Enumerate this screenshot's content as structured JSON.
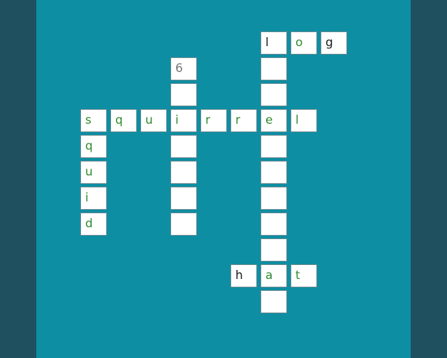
{
  "puzzle": {
    "cells": [
      {
        "letter": "l",
        "style": "dark"
      },
      {
        "letter": "o",
        "style": "green"
      },
      {
        "letter": "g",
        "style": "dark"
      },
      {
        "letter": "6",
        "style": "num"
      },
      {
        "letter": "",
        "style": "green"
      },
      {
        "letter": "",
        "style": "green"
      },
      {
        "letter": "",
        "style": "green"
      },
      {
        "letter": "s",
        "style": "green"
      },
      {
        "letter": "q",
        "style": "green"
      },
      {
        "letter": "u",
        "style": "green"
      },
      {
        "letter": "i",
        "style": "green"
      },
      {
        "letter": "r",
        "style": "green"
      },
      {
        "letter": "r",
        "style": "green"
      },
      {
        "letter": "e",
        "style": "green"
      },
      {
        "letter": "l",
        "style": "green"
      },
      {
        "letter": "q",
        "style": "green"
      },
      {
        "letter": "",
        "style": "green"
      },
      {
        "letter": "",
        "style": "green"
      },
      {
        "letter": "u",
        "style": "green"
      },
      {
        "letter": "",
        "style": "green"
      },
      {
        "letter": "",
        "style": "green"
      },
      {
        "letter": "i",
        "style": "green"
      },
      {
        "letter": "",
        "style": "green"
      },
      {
        "letter": "",
        "style": "green"
      },
      {
        "letter": "d",
        "style": "green"
      },
      {
        "letter": "",
        "style": "green"
      },
      {
        "letter": "",
        "style": "green"
      },
      {
        "letter": "",
        "style": "green"
      },
      {
        "letter": "h",
        "style": "dark"
      },
      {
        "letter": "a",
        "style": "green"
      },
      {
        "letter": "t",
        "style": "green"
      },
      {
        "letter": "",
        "style": "green"
      }
    ]
  }
}
